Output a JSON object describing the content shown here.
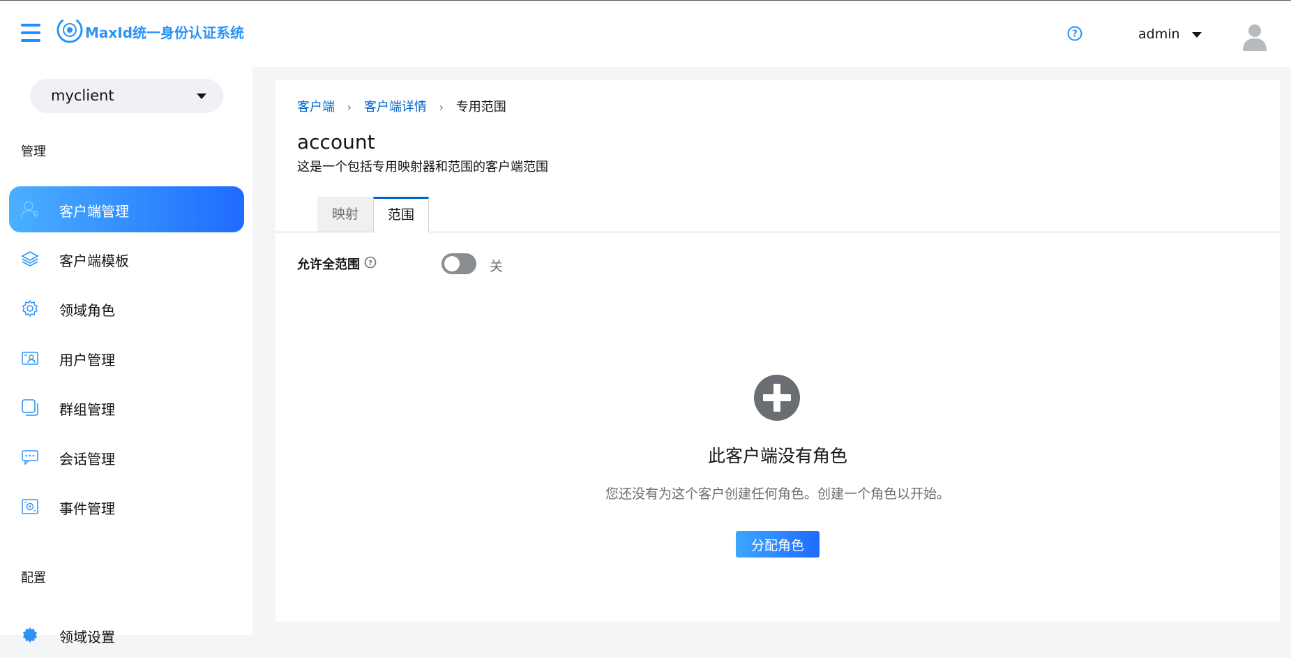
{
  "header": {
    "brand": "MaxId统一身份认证系统",
    "user": "admin"
  },
  "sidebar": {
    "client_select": "myclient",
    "section_manage": "管理",
    "items": [
      {
        "label": "客户端管理",
        "icon": "user-icon",
        "active": true
      },
      {
        "label": "客户端模板",
        "icon": "layers-icon",
        "active": false
      },
      {
        "label": "领域角色",
        "icon": "gear-icon",
        "active": false
      },
      {
        "label": "用户管理",
        "icon": "id-card-icon",
        "active": false
      },
      {
        "label": "群组管理",
        "icon": "group-icon",
        "active": false
      },
      {
        "label": "会话管理",
        "icon": "chat-icon",
        "active": false
      },
      {
        "label": "事件管理",
        "icon": "event-icon",
        "active": false
      }
    ],
    "section_config": "配置",
    "config_items": [
      {
        "label": "领域设置",
        "icon": "settings-icon"
      }
    ]
  },
  "breadcrumb": {
    "items": [
      "客户端",
      "客户端详情"
    ],
    "current": "专用范围"
  },
  "page": {
    "title": "account",
    "description": "这是一个包括专用映射器和范围的客户端范围"
  },
  "tabs": [
    {
      "label": "映射",
      "active": false
    },
    {
      "label": "范围",
      "active": true
    }
  ],
  "full_scope": {
    "label": "允许全范围",
    "state": "关",
    "enabled": false
  },
  "empty_state": {
    "title": "此客户端没有角色",
    "body": "您还没有为这个客户创建任何角色。创建一个角色以开始。",
    "button": "分配角色"
  },
  "colors": {
    "accent": "#1f8fff",
    "link": "#0066cc",
    "active_gradient_start": "#4ab0ff",
    "active_gradient_end": "#1f6bff"
  }
}
